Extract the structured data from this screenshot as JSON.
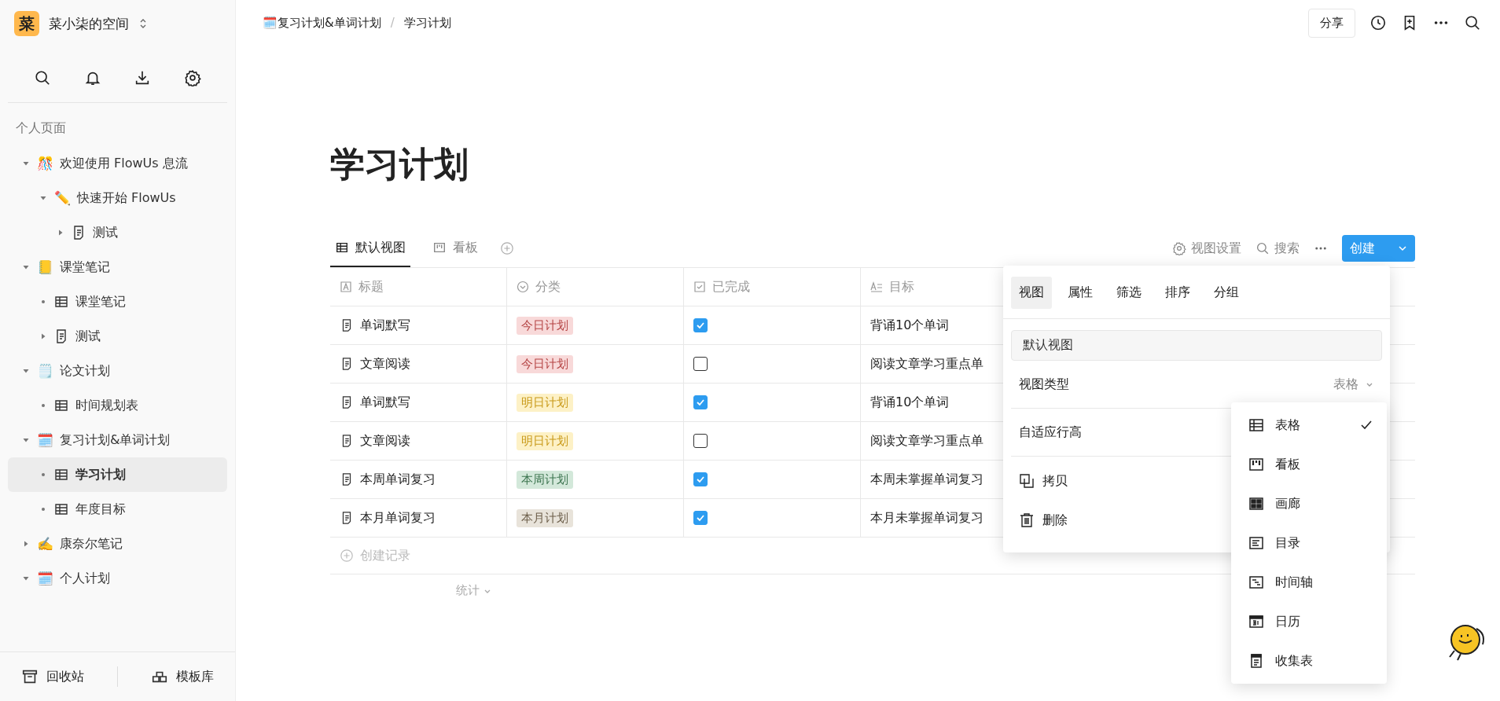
{
  "workspace": {
    "logo": "菜",
    "name": "菜小柒的空间"
  },
  "sidebar": {
    "section": "个人页面",
    "tree": [
      {
        "label": "欢迎使用 FlowUs 息流",
        "kind": "emoji",
        "emoji": "🎊",
        "expanded": true,
        "selected": false,
        "children": [
          {
            "label": "快速开始 FlowUs",
            "kind": "emoji",
            "emoji": "✏️",
            "expanded": true,
            "selected": false,
            "children": [
              {
                "label": "测试",
                "kind": "page",
                "expanded": false,
                "selected": false
              }
            ]
          }
        ]
      },
      {
        "label": "课堂笔记",
        "kind": "emoji",
        "emoji": "📒",
        "expanded": true,
        "selected": false,
        "children": [
          {
            "label": "课堂笔记",
            "kind": "table",
            "selected": false
          },
          {
            "label": "测试",
            "kind": "page",
            "expanded": false,
            "selected": false
          }
        ]
      },
      {
        "label": "论文计划",
        "kind": "emoji",
        "emoji": "🗒️",
        "expanded": true,
        "selected": false,
        "children": [
          {
            "label": "时间规划表",
            "kind": "table",
            "selected": false
          }
        ]
      },
      {
        "label": "复习计划&单词计划",
        "kind": "emoji",
        "emoji": "🗓️",
        "expanded": true,
        "selected": false,
        "children": [
          {
            "label": "学习计划",
            "kind": "table",
            "selected": true
          },
          {
            "label": "年度目标",
            "kind": "table",
            "selected": false
          }
        ]
      },
      {
        "label": "康奈尔笔记",
        "kind": "emoji",
        "emoji": "✍️",
        "expanded": false,
        "selected": false
      },
      {
        "label": "个人计划",
        "kind": "emoji",
        "emoji": "🗓️",
        "expanded": true,
        "selected": false
      }
    ],
    "footer": [
      "回收站",
      "模板库"
    ]
  },
  "breadcrumb_separator": "/",
  "breadcrumb": [
    {
      "label": "复习计划&单词计划",
      "emoji": "🗓️"
    },
    {
      "label": "学习计划"
    }
  ],
  "share_button": "分享",
  "page_title": "学习计划",
  "views": [
    {
      "label": "默认视图",
      "kind": "table",
      "selected": true
    },
    {
      "label": "看板",
      "kind": "board",
      "selected": false
    }
  ],
  "toolbar": {
    "settings": "视图设置",
    "search": "搜索",
    "create": "创建"
  },
  "table": {
    "columns": [
      {
        "label": "标题",
        "kind": "text"
      },
      {
        "label": "分类",
        "kind": "select"
      },
      {
        "label": "已完成",
        "kind": "check"
      },
      {
        "label": "目标",
        "kind": "longtext"
      }
    ],
    "rows": [
      {
        "title": "单词默写",
        "category": {
          "label": "今日计划",
          "color": "#b54545"
        },
        "done": true,
        "goal": "背诵10个单词"
      },
      {
        "title": "文章阅读",
        "category": {
          "label": "今日计划",
          "color": "#b54545"
        },
        "done": false,
        "goal": "阅读文章学习重点单"
      },
      {
        "title": "单词默写",
        "category": {
          "label": "明日计划",
          "color": "#c99a1a"
        },
        "done": true,
        "goal": "背诵10个单词"
      },
      {
        "title": "文章阅读",
        "category": {
          "label": "明日计划",
          "color": "#c99a1a"
        },
        "done": false,
        "goal": "阅读文章学习重点单"
      },
      {
        "title": "本周单词复习",
        "category": {
          "label": "本周计划",
          "color": "#3d7550"
        },
        "done": true,
        "goal": "本周未掌握单词复习"
      },
      {
        "title": "本月单词复习",
        "category": {
          "label": "本月计划",
          "color": "#6d5f4b"
        },
        "done": true,
        "goal": "本月未掌握单词复习"
      }
    ],
    "add_record": "创建记录",
    "stats": "统计"
  },
  "view_settings": {
    "tabs": [
      {
        "label": "视图",
        "selected": true
      },
      {
        "label": "属性",
        "selected": false
      },
      {
        "label": "筛选",
        "selected": false
      },
      {
        "label": "排序",
        "selected": false
      },
      {
        "label": "分组",
        "selected": false
      }
    ],
    "name_value": "默认视图",
    "view_type_label": "视图类型",
    "view_type_value": "表格",
    "auto_height_label": "自适应行高",
    "actions": [
      {
        "label": "拷贝",
        "kind": "copy"
      },
      {
        "label": "删除",
        "kind": "delete"
      }
    ]
  },
  "view_type_menu": [
    {
      "label": "表格",
      "kind": "table",
      "selected": true
    },
    {
      "label": "看板",
      "kind": "board",
      "selected": false
    },
    {
      "label": "画廊",
      "kind": "gallery",
      "selected": false
    },
    {
      "label": "目录",
      "kind": "list",
      "selected": false
    },
    {
      "label": "时间轴",
      "kind": "timeline",
      "selected": false
    },
    {
      "label": "日历",
      "kind": "calendar",
      "selected": false
    },
    {
      "label": "收集表",
      "kind": "form",
      "selected": false
    }
  ]
}
